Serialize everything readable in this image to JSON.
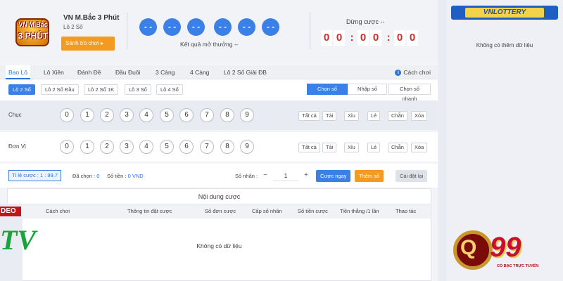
{
  "header": {
    "logo_line1": "VN M.Bắc",
    "logo_line2": "3 PHÚT",
    "game_title": "VN M.Bắc 3 Phút",
    "game_sub": "Lô 2 Số",
    "lobby_button": "Sảnh trò chơi ▸",
    "result_balls": [
      "- -",
      "- -",
      "- -",
      "- -",
      "- -",
      "- -"
    ],
    "result_label": "Kết quả mở thưởng --",
    "stop_label": "Dừng cược --",
    "timer_digits": [
      "0",
      "0",
      ":",
      "0",
      "0",
      ":",
      "0",
      "0"
    ]
  },
  "tabs": {
    "items": [
      "Bao Lô",
      "Lô Xiên",
      "Đánh Đề",
      "Đầu Đuôi",
      "3 Càng",
      "4 Càng",
      "Lô 2 Số Giải ĐB"
    ],
    "active": "Bao Lô",
    "howto": "Cách chơi"
  },
  "subtabs": {
    "items": [
      "Lô 2 Số",
      "Lô 2 Số Đầu",
      "Lô 2 Số 1K",
      "Lô 3 Số",
      "Lô 4 Số"
    ],
    "modes": [
      "Chọn số",
      "Nhập số",
      "Chọn số nhanh"
    ]
  },
  "rows": [
    {
      "label": "Chục"
    },
    {
      "label": "Đơn Vị"
    }
  ],
  "digits": [
    "0",
    "1",
    "2",
    "3",
    "4",
    "5",
    "6",
    "7",
    "8",
    "9"
  ],
  "quick": [
    "Tất cả",
    "Tài",
    "Xỉu",
    "Lẻ",
    "Chẵn",
    "Xóa"
  ],
  "betbar": {
    "ratio": "Tỉ lệ cược : 1 : 99.7",
    "chosen_label": "Đã chọn : ",
    "chosen_value": "0",
    "money_label": "Số tiền : ",
    "money_value": "0 VND",
    "multiplier_label": "Số nhân :",
    "minus": "−",
    "multiplier_value": "1",
    "plus": "+",
    "bet_now": "Cược ngay",
    "add_number": "Thêm số",
    "reset": "Cài đặt lại"
  },
  "content": {
    "title": "Nội dung cược",
    "columns": [
      "Cách chơi",
      "Thông tin đặt cược",
      "Số đơn cược",
      "Cấp số nhân",
      "Số tiền cược",
      "Tiền thắng /1 lần",
      "Thao tác"
    ],
    "empty": "Không có dữ liệu"
  },
  "overlay": {
    "deo": "DEO",
    "tv": "TV"
  },
  "side": {
    "brand": "VNLOTTERY",
    "empty": "Không có thêm dữ liệu"
  },
  "watermark": {
    "q": "Q",
    "num": "99",
    "sub": "CỔ BẠC TRỰC TUYẾN"
  }
}
